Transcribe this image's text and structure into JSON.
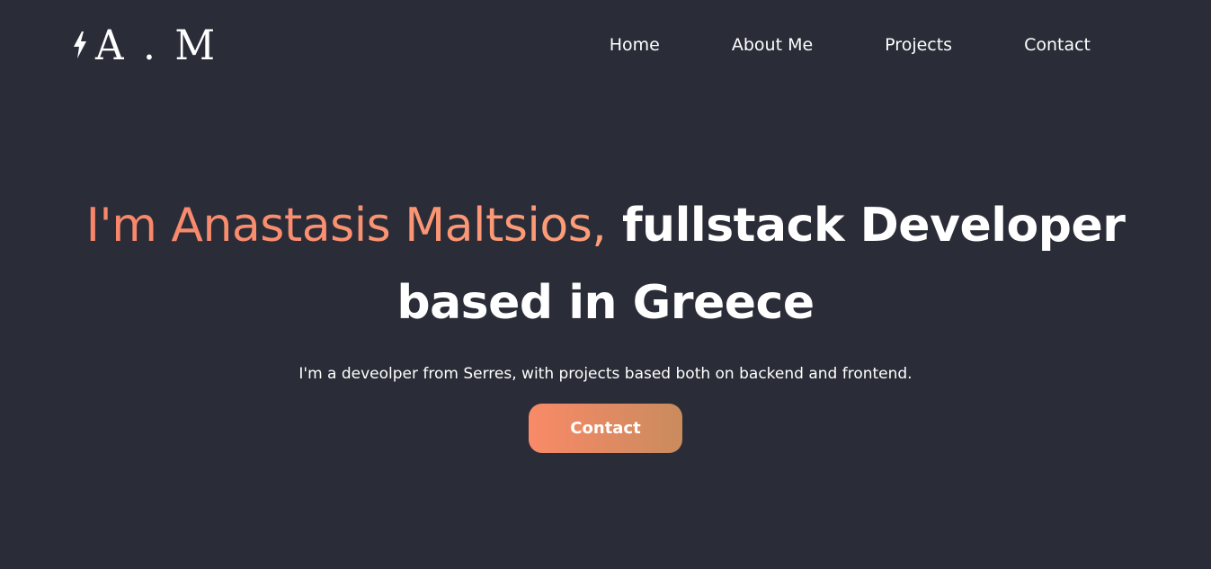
{
  "logo": {
    "text": "A . M",
    "icon": "lightning-bolt-icon"
  },
  "nav": {
    "items": [
      {
        "label": "Home"
      },
      {
        "label": "About Me"
      },
      {
        "label": "Projects"
      },
      {
        "label": "Contact"
      }
    ]
  },
  "hero": {
    "title_highlight": "I'm Anastasis Maltsios,",
    "title_rest": "fullstack Developer based in Greece",
    "subtitle": "I'm a deveolper from Serres, with projects based both on backend and frontend.",
    "cta_label": "Contact"
  },
  "colors": {
    "background": "#2a2c37",
    "accent_start": "#f7856a",
    "accent_end": "#fd9e79",
    "button_start": "#f98a68",
    "button_end": "#c98b5d",
    "text": "#ffffff"
  }
}
